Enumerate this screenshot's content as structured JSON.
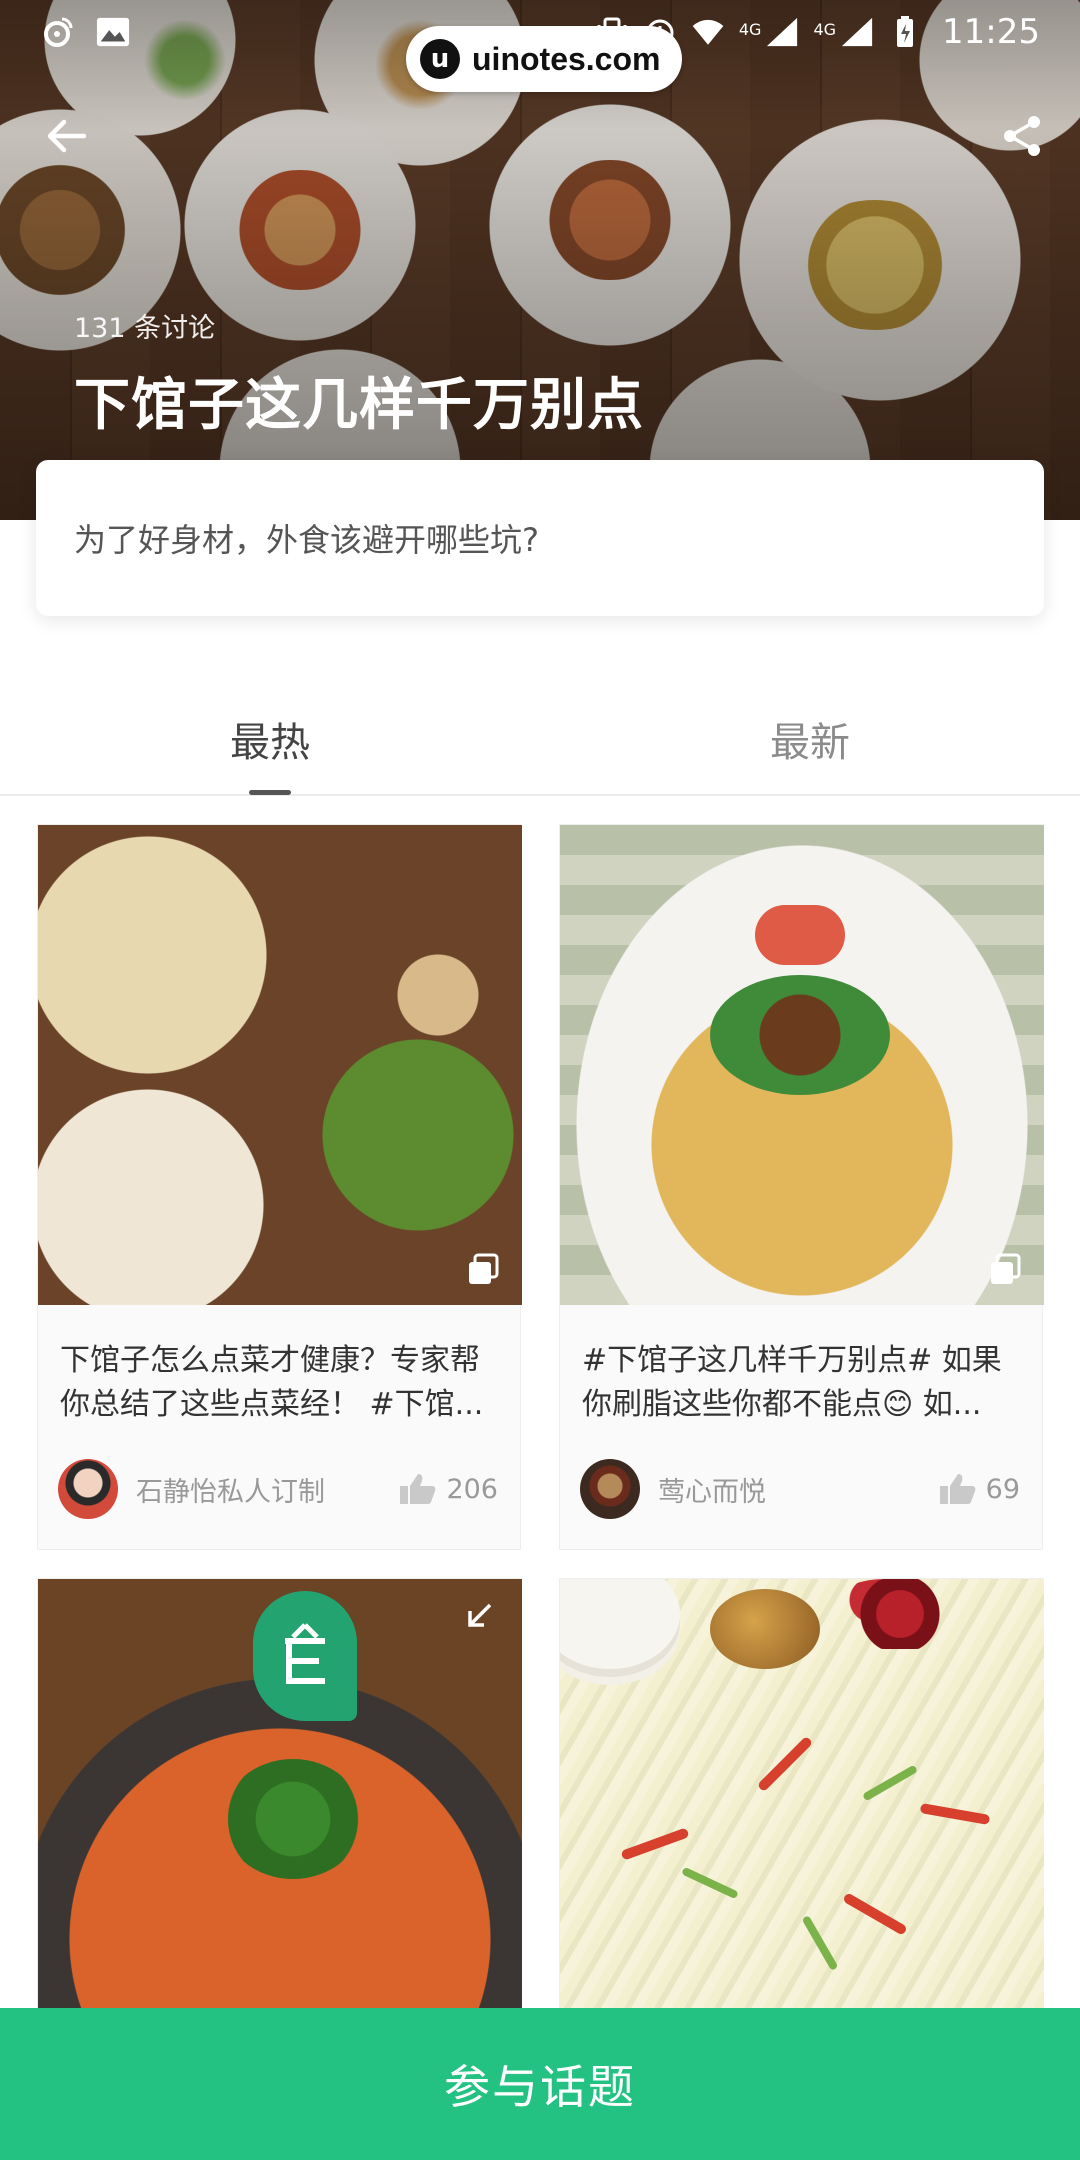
{
  "status_bar": {
    "time": "11:25",
    "network_1": "4G",
    "network_2": "4G"
  },
  "watermark": {
    "logo_letter": "u",
    "text": "uinotes.com"
  },
  "header": {
    "discussion_count": "131 条讨论",
    "title": "下馆子这几样千万别点",
    "question": "为了好身材，外食该避开哪些坑?"
  },
  "tabs": [
    {
      "label": "最热",
      "active": true
    },
    {
      "label": "最新",
      "active": false
    }
  ],
  "posts": [
    {
      "text": "下馆子怎么点菜才健康？专家帮你总结了这些点菜经！ #下馆...",
      "author": "石静怡私人订制",
      "likes": "206"
    },
    {
      "text": "#下馆子这几样千万别点# 如果你刷脂这些你都不能点😊 如...",
      "author": "莺心而悦",
      "likes": "69"
    },
    {
      "text": "",
      "author": "",
      "likes": ""
    },
    {
      "text": "",
      "author": "",
      "likes": ""
    }
  ],
  "bottom_action": {
    "label": "参与话题"
  },
  "colors": {
    "accent": "#23c283",
    "tab_active": "#444444",
    "tab_inactive": "#8b8b8b"
  }
}
